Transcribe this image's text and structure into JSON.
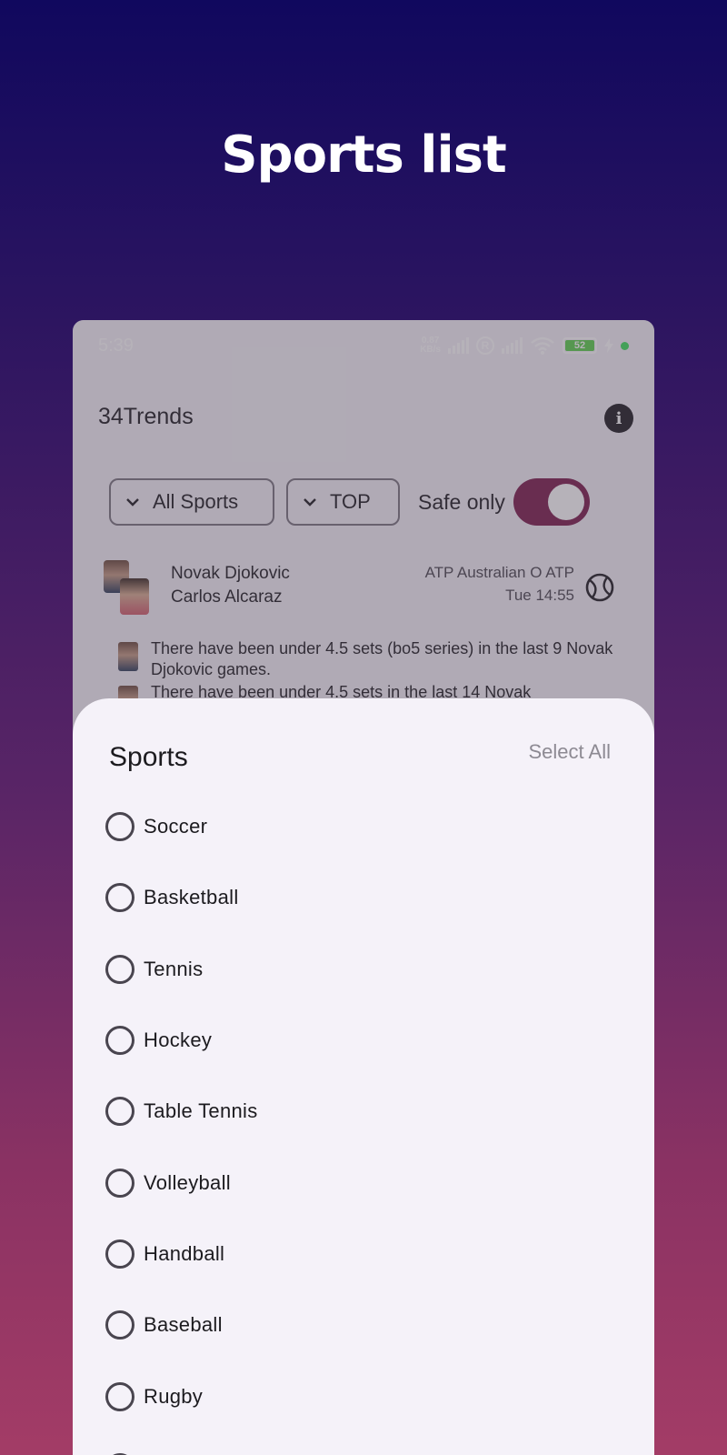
{
  "promo": {
    "title": "Sports list"
  },
  "status_bar": {
    "time": "5:39",
    "net_speed_value": "0.87",
    "net_speed_unit": "KB/s",
    "battery": "52"
  },
  "app": {
    "title": "34Trends"
  },
  "filters": {
    "sport_filter": "All Sports",
    "sort_filter": "TOP",
    "safe_only_label": "Safe only",
    "safe_only": true
  },
  "event": {
    "player1": "Novak Djokovic",
    "player2": "Carlos Alcaraz",
    "league": "ATP Australian O ATP",
    "time": "Tue 14:55",
    "sport_icon": "tennis-ball-icon"
  },
  "trends": [
    "There have been under 4.5 sets (bo5 series) in the last 9 Novak Djokovic games.",
    "There have been under 4.5 sets in the last 14 Novak"
  ],
  "sheet": {
    "title": "Sports",
    "select_all": "Select All",
    "sports": [
      "Soccer",
      "Basketball",
      "Tennis",
      "Hockey",
      "Table Tennis",
      "Volleyball",
      "Handball",
      "Baseball",
      "Rugby"
    ]
  },
  "colors": {
    "accent": "#7a1a4a",
    "background_top": "#10085e",
    "background_bottom": "#a33c66"
  }
}
